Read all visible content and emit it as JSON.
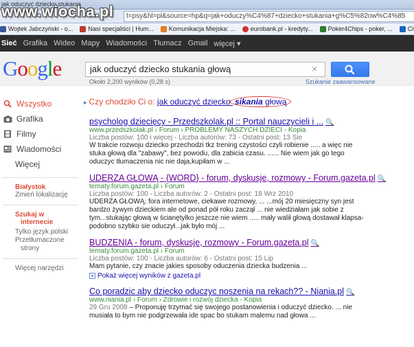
{
  "browser": {
    "tab_title": "jak oduczyć dziecko stukania",
    "url": "t=psy&hl=pl&source=hp&q=jak+oduczy%C4%87+dziecko+stukania+g%C5%82ow%C4%85",
    "watermark": "www.wiocha.pl",
    "bookmarks": [
      {
        "label": "Wojtek Jabczyński - o...",
        "color": "#3b5998"
      },
      {
        "label": "Nasi specjaliści | Hum...",
        "color": "#c0392b"
      },
      {
        "label": "Komunikacja Miejska: ...",
        "color": "#e67e22"
      },
      {
        "label": "eurobank.pl - kredyty...",
        "color": "#d32f2f"
      },
      {
        "label": "Poker4Chips - poker, ...",
        "color": "#2e7d32"
      },
      {
        "label": "Citi Handlowy",
        "color": "#1565c0"
      }
    ]
  },
  "gbar": {
    "items": [
      "Sieć",
      "Grafika",
      "Wideo",
      "Mapy",
      "Wiadomości",
      "Tłumacz",
      "Gmail",
      "więcej ▾"
    ]
  },
  "search": {
    "query": "jak oduczyć dziecko stukania głową",
    "clear": "×",
    "result_count": "Około 2,200 wyników (0,28 s)",
    "advanced": "Szukanie zaawansowane"
  },
  "leftnav": {
    "items": [
      {
        "label": "Wszystko",
        "icon": "search-icon"
      },
      {
        "label": "Grafika",
        "icon": "camera-icon"
      },
      {
        "label": "Filmy",
        "icon": "film-icon"
      },
      {
        "label": "Wiadomości",
        "icon": "news-icon"
      },
      {
        "label": "Więcej",
        "icon": ""
      }
    ],
    "location_name": "Białystok",
    "location_change": "Zmień lokalizację",
    "lang_head_1": "Szukaj w",
    "lang_head_2": "internecie",
    "lang_opt_1": "Tylko język polski",
    "lang_opt_2a": "Przetłumaczone",
    "lang_opt_2b": "strony",
    "more_tools": "Więcej narzędzi"
  },
  "didyoumean": {
    "prefix": "Czy chodziło Ci o:",
    "q_start": "jak oduczyć dziecko",
    "q_bold": "sikania",
    "q_end": "głową"
  },
  "results": [
    {
      "title": "psycholog dziecięcy - Przedszkolak.pl :: Portal nauczycieli i ...",
      "url": "www.przedszkolak.pl › Forum › PROBLEMY NASZYCH DZIECI - Kopia",
      "meta": "Liczba postów: 100 i więcej - Liczba autorów: 73 - Ostatni post: 13 Sie",
      "snippet_1": "W trakcie rozwoju dziecko przechodzi tkz trening czystości czyli robienie ..... a więc nie",
      "snippet_2": "stuka głową dla \"zabawy\", bez powodu, dla zabicia czasu. ...... Nie wiem jak go tego",
      "snippet_3": "oduczyc tłumaczenia nic nie daja,kupiłam w ..."
    },
    {
      "title": "UDERZA GŁOWĄ - {WORD} - forum, dyskusje, rozmowy - Forum.gazeta.pl",
      "url": "tematy.forum.gazeta.pl › Forum",
      "meta": "Liczba postów: 100 - Liczba autorów: 2 - Ostatni post: 18 Wrz 2010",
      "snippet_1": "UDERZA GŁOWĄ; fora internetowe, ciekawe rozmowy, ... ...mój 20 miesięczny syn jest",
      "snippet_2": "bardzo żywym dzieckiem ale od ponad pół roku zaczął ... nie wiedziałam jak sobie z",
      "snippet_3": "tym...stukając głową w ścianętylko jeszcze nie wiem ..... mały walił głową dostawał klapsa-",
      "snippet_4": "podobno szybko sie oduczył...jak było mój ..."
    },
    {
      "title": "BUDZENIA - forum, dyskusje, rozmowy - Forum.gazeta.pl",
      "url": "tematy.forum.gazeta.pl › Forum",
      "meta": "Liczba postów: 100 - Liczba autorów: 6 - Ostatni post: 15 Lip",
      "snippet_1": "Mam pytanie, czy znacie jakies sposoby oduczenia dziecka budzenia ...",
      "more": "Pokaż więcej wyników z gazeta.pl"
    },
    {
      "title": "Co poradzic aby dziecko oduczyc noszenia na rekach?? - Niania.pl",
      "url": "www.niania.pl › Forum › Zdrowie i rozwój dziecka - Kopia",
      "meta": "29 Gru 2008",
      "snippet_1": " – Proponuję trzymać się swojego postanowienia i oduczyć dziecko. ... nie",
      "snippet_2": "musiała to bym nie podgrzewała ide spac bo stukam malemu nad głowa ..."
    }
  ]
}
